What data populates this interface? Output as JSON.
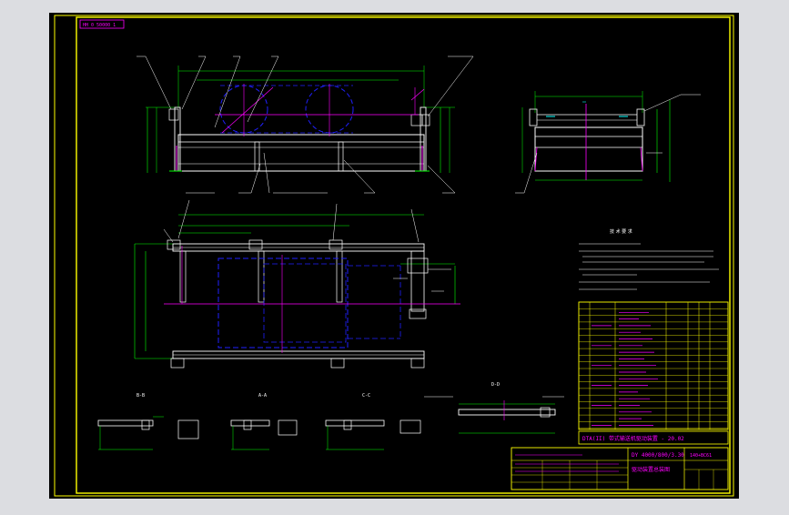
{
  "colors": {
    "canvas": "#dcdde1",
    "sheet": "#000000",
    "frame": "#ffff00",
    "outline": "#ffffff",
    "dimension": "#00ff00",
    "center": "#ff00ff",
    "hidden": "#2020ff",
    "leader": "#00ffff",
    "note": "#ffffff"
  },
  "drawing": {
    "corner_tag": "HH 0 50000 1",
    "title_line": "DTA(II) 带式输送机驱动装置 - 20.02",
    "code_line": "DY 4000/800/3.30",
    "code_right": "140+BC61",
    "assembly_line": "驱动装置总装图",
    "notes_heading": "技 术 要 求",
    "section_labels": [
      "B-B",
      "A-A",
      "C-C",
      "D-D"
    ]
  }
}
